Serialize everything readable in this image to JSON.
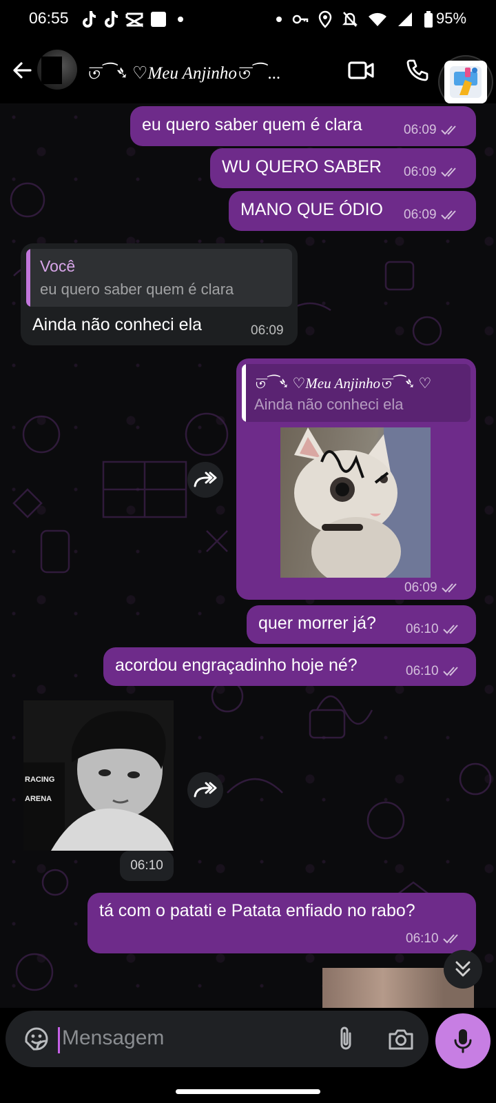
{
  "status_bar": {
    "time": "06:55",
    "battery": "95%",
    "icons": [
      "tiktok-icon",
      "tiktok-icon",
      "capcut-icon",
      "square-notification-icon",
      "dot-icon",
      "dot-icon",
      "key-icon",
      "location-icon",
      "bell-muted-icon",
      "wifi-icon",
      "signal-icon",
      "battery-icon"
    ]
  },
  "header": {
    "contact_name": "ত⁀➴ ♡Meu Anjinhoত⁀ ...",
    "back_icon": "back-arrow-icon",
    "video_icon": "video-call-icon",
    "call_icon": "phone-icon"
  },
  "messages": [
    {
      "id": "m1",
      "direction": "out",
      "text": "eu quero saber quem é clara",
      "time": "06:09",
      "status": "read"
    },
    {
      "id": "m2",
      "direction": "out",
      "text": "WU QUERO SABER",
      "time": "06:09",
      "status": "read"
    },
    {
      "id": "m3",
      "direction": "out",
      "text": "MANO QUE ÓDIO",
      "time": "06:09",
      "status": "read"
    },
    {
      "id": "m4",
      "direction": "in",
      "quote_author": "Você",
      "quote_text": "eu quero saber quem é clara",
      "text": "Ainda não conheci ela",
      "time": "06:09"
    },
    {
      "id": "m5",
      "direction": "out",
      "quote_author": "ত⁀➴ ♡Meu Anjinhoত⁀➴ ♡",
      "quote_text": "Ainda não conheci ela",
      "media": "cat-photo",
      "time": "06:09",
      "status": "read"
    },
    {
      "id": "m6",
      "direction": "out",
      "text": "quer morrer já?",
      "time": "06:10",
      "status": "read"
    },
    {
      "id": "m7",
      "direction": "out",
      "text": "acordou engraçadinho hoje né?",
      "time": "06:10",
      "status": "read"
    },
    {
      "id": "m8",
      "direction": "in",
      "media": "person-photo",
      "photo_text": [
        "RACING",
        "ARENA"
      ],
      "time": "06:10"
    },
    {
      "id": "m9",
      "direction": "out",
      "text": "tá com o patati e Patata enfiado no rabo?",
      "time": "06:10",
      "status": "read"
    }
  ],
  "input": {
    "placeholder": "Mensagem",
    "value": ""
  },
  "colors": {
    "outgoing_bubble": "#6e2b8a",
    "incoming_bubble": "#1d1f21",
    "mic_button": "#c77ee3",
    "quote_in_accent": "#c277dc",
    "quote_out_accent": "#ffffff"
  }
}
